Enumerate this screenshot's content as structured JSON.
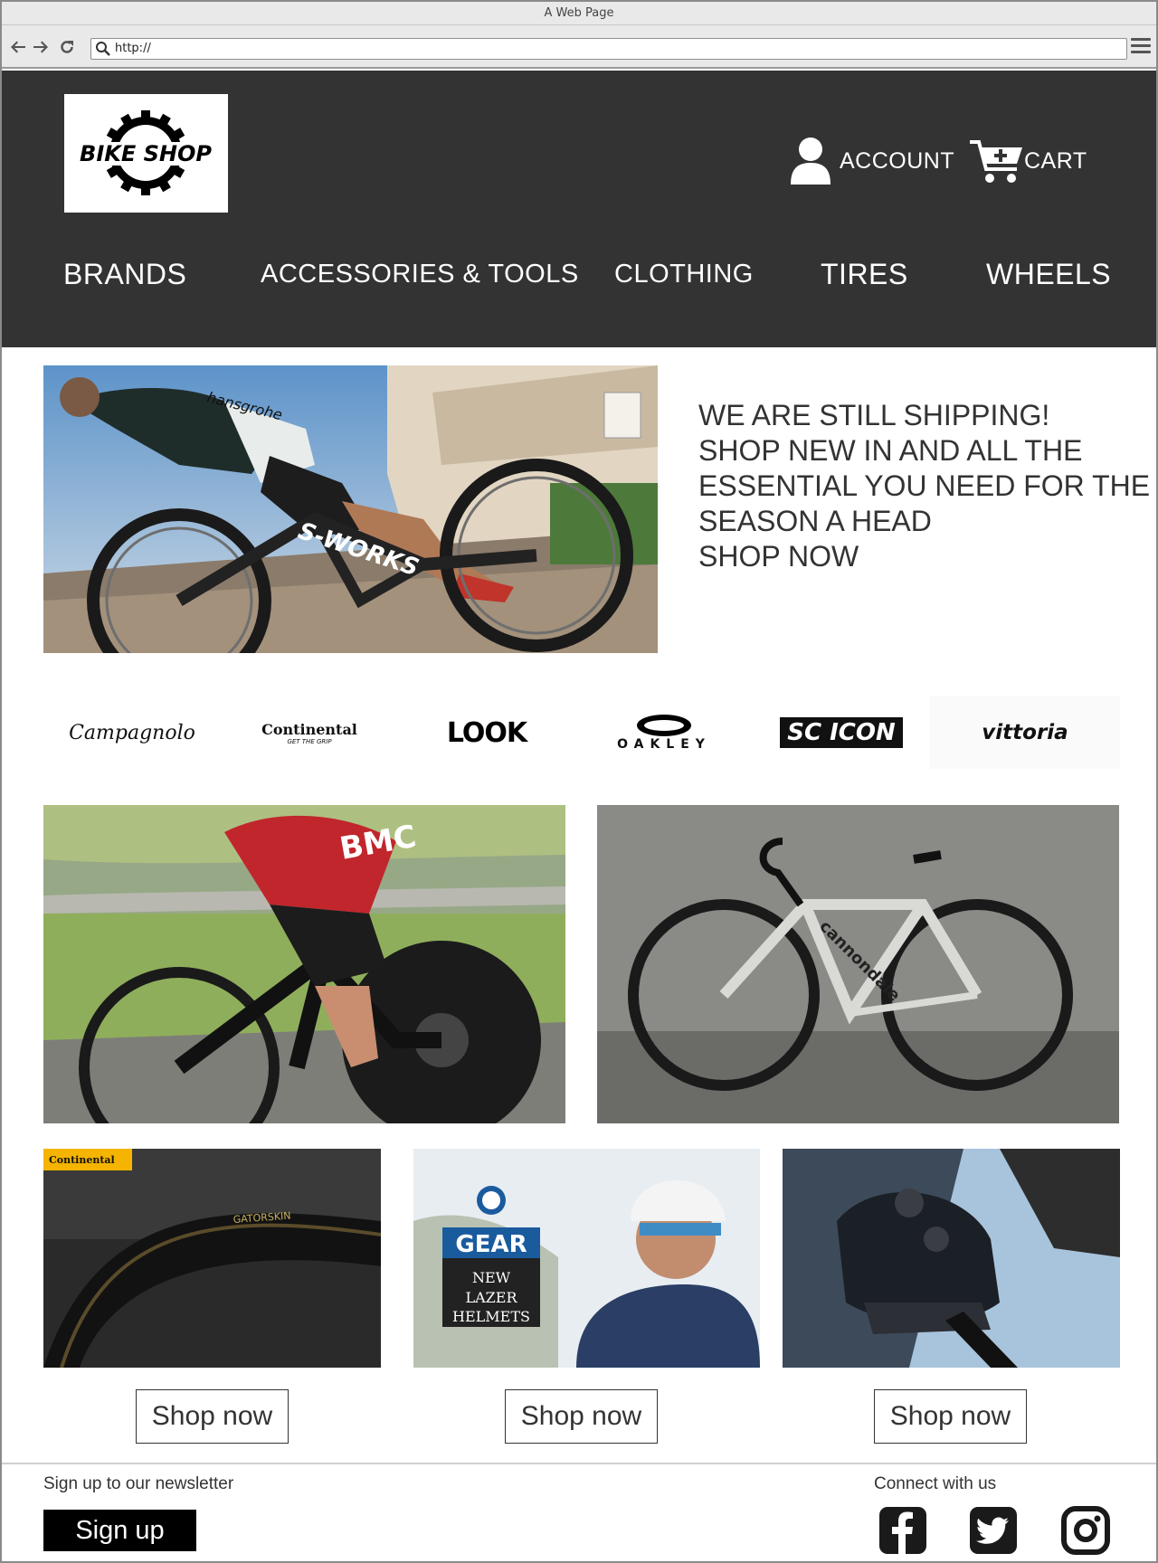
{
  "browser": {
    "window_title": "A Web Page",
    "url": "http://"
  },
  "header": {
    "logo_text": "BIKE SHOP",
    "account_label": "ACCOUNT",
    "cart_label": "CART",
    "icons": [
      "user-icon",
      "cart-add-icon"
    ]
  },
  "menu": {
    "items": [
      {
        "label": "BRANDS"
      },
      {
        "label": "ACCESSORIES & TOOLS"
      },
      {
        "label": "CLOTHING"
      },
      {
        "label": "TIRES"
      },
      {
        "label": "WHEELS"
      }
    ]
  },
  "hero": {
    "lines": [
      "WE ARE STILL SHIPPING!",
      "SHOP NEW IN AND ALL THE",
      "ESSENTIAL YOU NEED FOR THE",
      "SEASON A HEAD",
      "SHOP NOW"
    ],
    "image_overlays": [
      "hansgrohe",
      "S-WORKS"
    ]
  },
  "brands": [
    {
      "name": "Campagnolo"
    },
    {
      "name": "Continental",
      "tagline": "GET THE GRIP"
    },
    {
      "name": "LOOK"
    },
    {
      "name": "OAKLEY"
    },
    {
      "name": "SC ICON"
    },
    {
      "name": "vittoria"
    }
  ],
  "features": [
    {
      "overlay": "BMC"
    },
    {
      "overlay": "cannondale"
    }
  ],
  "products": [
    {
      "badge": "Continental",
      "overlay": "GATORSKIN",
      "button": "Shop now"
    },
    {
      "overlay_title": "GEAR",
      "overlay_lines": [
        "NEW",
        "LAZER",
        "HELMETS"
      ],
      "button": "Shop now"
    },
    {
      "button": "Shop now"
    }
  ],
  "footer": {
    "newsletter_label": "Sign up to our newsletter",
    "signup_button": "Sign up",
    "connect_label": "Connect with us",
    "social": [
      "facebook-icon",
      "twitter-icon",
      "instagram-icon"
    ]
  }
}
